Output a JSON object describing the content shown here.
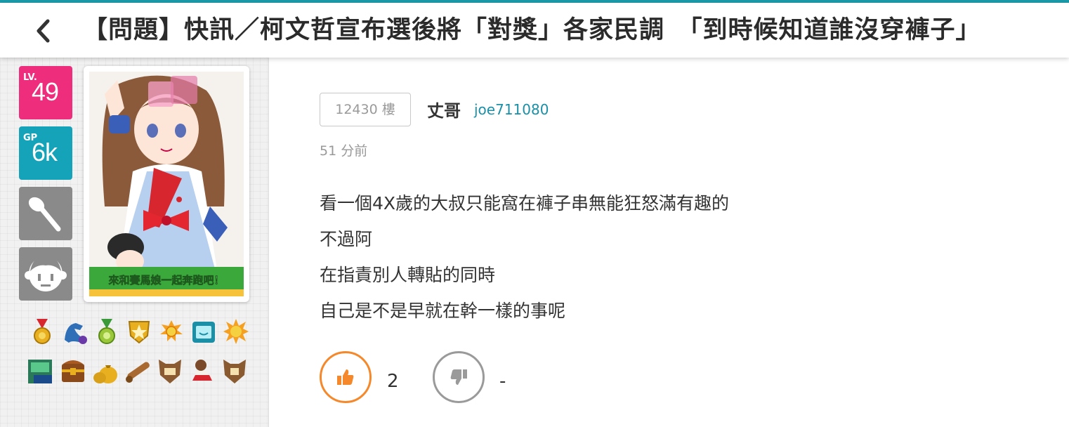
{
  "header": {
    "title": "【問題】快訊／柯文哲宣布選後將「對獎」各家民調　「到時候知道誰沒穿褲子」"
  },
  "sidebar": {
    "level": {
      "tag": "LV.",
      "value": "49"
    },
    "gp": {
      "tag": "GP",
      "value": "6k"
    },
    "avatar_banner": "來和賽馬娘一起奔跑吧！"
  },
  "post": {
    "floor": "12430 樓",
    "author_name": "丈哥",
    "author_id": "joe711080",
    "time": "51 分前",
    "lines": [
      "看一個4X歲的大叔只能窩在褲子串無能狂怒滿有趣的",
      "不過阿",
      "在指責別人轉貼的同時",
      "自己是不是早就在幹一樣的事呢"
    ],
    "upvotes": "2",
    "downvotes": "-"
  },
  "colors": {
    "accent": "#1b9aaa",
    "level_badge": "#ef2d7d",
    "gp_badge": "#15a3ba",
    "like": "#f5882a",
    "dislike": "#9a9a9a"
  }
}
